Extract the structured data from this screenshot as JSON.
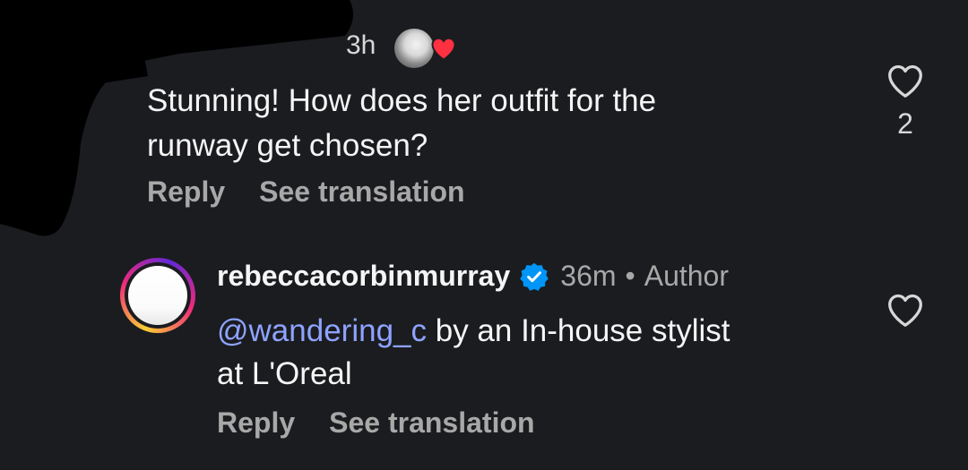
{
  "comment_1": {
    "time": "3h",
    "text_line_1": "Stunning! How does her outfit for the",
    "text_line_2": "runway get chosen?",
    "reply_label": "Reply",
    "translate_label": "See translation",
    "like_count": "2",
    "liked_by_author": true
  },
  "comment_2": {
    "username": "rebeccacorbinmurray",
    "verified": true,
    "time": "36m",
    "separator": "•",
    "badge": "Author",
    "mention": "@wandering_c",
    "text_rest_line_1": " by an In-house stylist",
    "text_line_2": "at L'Oreal",
    "reply_label": "Reply",
    "translate_label": "See translation"
  },
  "colors": {
    "background": "#1b1c20",
    "mention": "#8ea3ff",
    "heart_red": "#ff3040",
    "verified_blue": "#0095f6"
  },
  "icons": {
    "like": "heart-outline-icon",
    "author_liked": "heart-filled-icon",
    "verified": "verified-badge-icon"
  }
}
